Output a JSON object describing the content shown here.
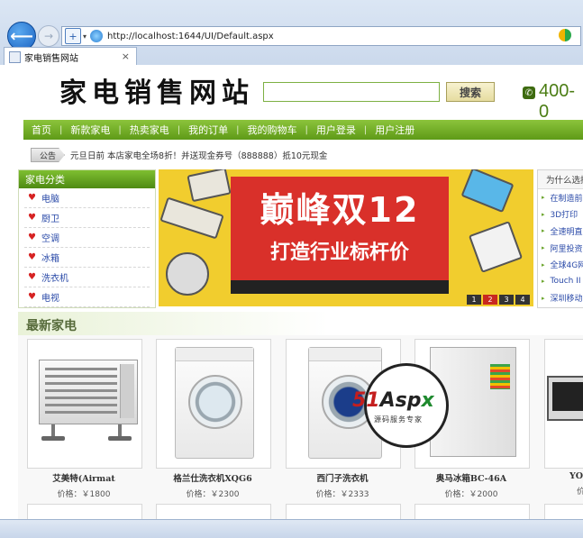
{
  "browser": {
    "url": "http://localhost:1644/UI/Default.aspx",
    "tab_title": "家电销售网站",
    "tab_close": "×"
  },
  "header": {
    "logo": "家电销售网站",
    "search_placeholder": "",
    "search_button": "搜索",
    "phone": "400-0"
  },
  "nav": {
    "items": [
      "首页",
      "新款家电",
      "热卖家电",
      "我的订单",
      "我的购物车",
      "用户登录",
      "用户注册"
    ]
  },
  "notice": {
    "badge": "公告",
    "text": "元旦日前 本店家电全场8折！并送现金券号（888888）抵10元现金"
  },
  "categories": {
    "title": "家电分类",
    "items": [
      "电脑",
      "厨卫",
      "空调",
      "冰箱",
      "洗衣机",
      "电视"
    ]
  },
  "banner": {
    "line1": "巅峰双12",
    "line2": "打造行业标杆价",
    "pages": [
      "1",
      "2",
      "3",
      "4"
    ],
    "active_page": 2
  },
  "why": {
    "title": "为什么选择",
    "items": [
      "在制造前",
      "3D打印",
      "全速明直",
      "阿里投资",
      "全球4G网",
      "Touch II",
      "深圳移动"
    ]
  },
  "latest": {
    "title": "最新家电",
    "products": [
      {
        "name": "艾美特(Airmat",
        "price": "价格：￥1800"
      },
      {
        "name": "格兰仕洗衣机XQG6",
        "price": "价格：￥2300"
      },
      {
        "name": "西门子洗衣机",
        "price": "价格：￥2333"
      },
      {
        "name": "奥马冰箱BC-46A",
        "price": "价格：￥2000"
      },
      {
        "name": "YO",
        "price": "价"
      }
    ]
  },
  "watermark": {
    "brand_a": "51",
    "brand_b": "Asp",
    "brand_c": "x",
    "sub": "源码服务专家"
  },
  "colors": {
    "nav_green": "#6aa51f",
    "banner_yellow": "#f1cd2e",
    "banner_red": "#d9302a",
    "link_blue": "#2a4aa8"
  }
}
